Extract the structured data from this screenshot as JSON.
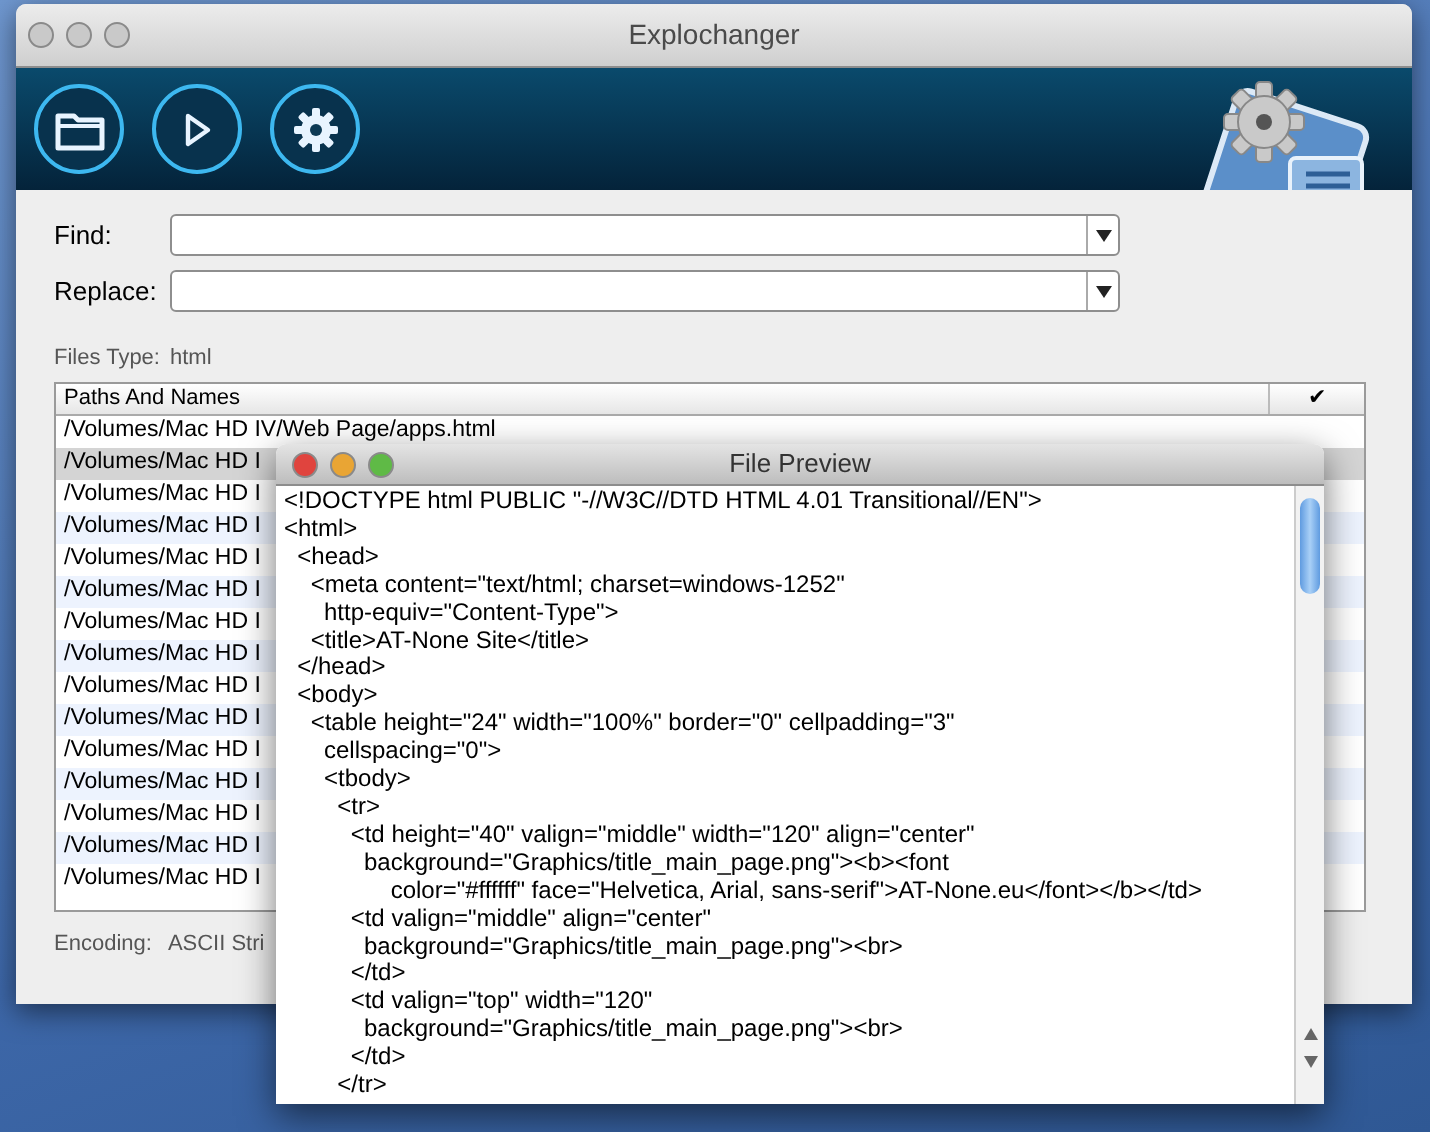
{
  "window": {
    "title": "Explochanger"
  },
  "toolbar": {
    "buttons": [
      {
        "kind": "folder"
      },
      {
        "kind": "play"
      },
      {
        "kind": "gear"
      }
    ]
  },
  "form": {
    "fields": [
      {
        "label": "Find:"
      },
      {
        "label": "Replace:"
      }
    ],
    "files_type": {
      "label": "Files Type:",
      "value": "html"
    }
  },
  "table": {
    "columns": [
      "Paths And Names",
      "✔"
    ],
    "rows": [
      {
        "path": "/Volumes/Mac HD IV/Web Page/apps.html",
        "selected": false
      },
      {
        "path": "/Volumes/Mac HD I",
        "selected": true
      },
      {
        "path": "/Volumes/Mac HD I",
        "selected": false
      },
      {
        "path": "/Volumes/Mac HD I",
        "selected": false
      },
      {
        "path": "/Volumes/Mac HD I",
        "selected": false
      },
      {
        "path": "/Volumes/Mac HD I",
        "selected": false
      },
      {
        "path": "/Volumes/Mac HD I",
        "selected": false
      },
      {
        "path": "/Volumes/Mac HD I",
        "selected": false
      },
      {
        "path": "/Volumes/Mac HD I",
        "selected": false
      },
      {
        "path": "/Volumes/Mac HD I",
        "selected": false
      },
      {
        "path": "/Volumes/Mac HD I",
        "selected": false
      },
      {
        "path": "/Volumes/Mac HD I",
        "selected": false
      },
      {
        "path": "/Volumes/Mac HD I",
        "selected": false
      },
      {
        "path": "/Volumes/Mac HD I",
        "selected": false
      },
      {
        "path": "/Volumes/Mac HD I",
        "selected": false
      }
    ]
  },
  "encoding": {
    "label": "Encoding:",
    "value": "ASCII Stri"
  },
  "preview": {
    "title": "File Preview",
    "lines": [
      "<!DOCTYPE html PUBLIC \"-//W3C//DTD HTML 4.01 Transitional//EN\">",
      "<html>",
      "  <head>",
      "    <meta content=\"text/html; charset=windows-1252\"",
      "      http-equiv=\"Content-Type\">",
      "    <title>AT-None Site</title>",
      "  </head>",
      "  <body>",
      "    <table height=\"24\" width=\"100%\" border=\"0\" cellpadding=\"3\"",
      "      cellspacing=\"0\">",
      "      <tbody>",
      "        <tr>",
      "          <td height=\"40\" valign=\"middle\" width=\"120\" align=\"center\"",
      "            background=\"Graphics/title_main_page.png\"><b><font",
      "                color=\"#ffffff\" face=\"Helvetica, Arial, sans-serif\">AT-None.eu</font></b></td>",
      "          <td valign=\"middle\" align=\"center\"",
      "            background=\"Graphics/title_main_page.png\"><br>",
      "          </td>",
      "          <td valign=\"top\" width=\"120\"",
      "            background=\"Graphics/title_main_page.png\"><br>",
      "          </td>",
      "        </tr>"
    ]
  }
}
